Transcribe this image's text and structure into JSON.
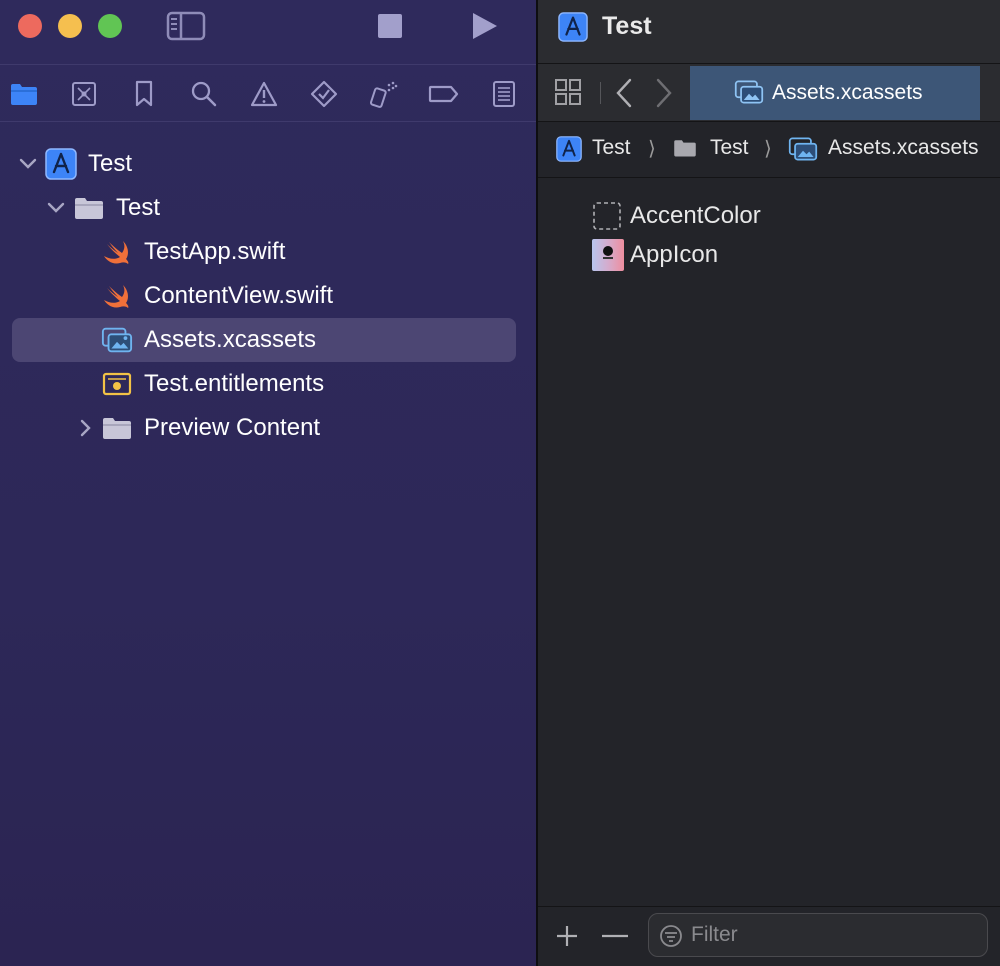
{
  "window": {
    "title": "Test"
  },
  "toolbar": {
    "run_icon": "play-icon",
    "stop_icon": "stop-icon",
    "sidebar_icon": "sidebar-toggle-icon"
  },
  "navigator_tabs": [
    {
      "name": "project-navigator",
      "icon": "folder-icon"
    },
    {
      "name": "source-control",
      "icon": "source-control-icon"
    },
    {
      "name": "bookmarks",
      "icon": "bookmark-icon"
    },
    {
      "name": "find",
      "icon": "magnifier-icon"
    },
    {
      "name": "issues",
      "icon": "warning-icon"
    },
    {
      "name": "tests",
      "icon": "test-diamond-icon"
    },
    {
      "name": "debug",
      "icon": "spray-icon"
    },
    {
      "name": "breakpoints",
      "icon": "breakpoint-icon"
    },
    {
      "name": "reports",
      "icon": "report-icon"
    }
  ],
  "tree": [
    {
      "label": "Test",
      "icon": "xcode-project-icon",
      "expanded": true,
      "level": 0
    },
    {
      "label": "Test",
      "icon": "folder-icon",
      "expanded": true,
      "level": 1
    },
    {
      "label": "TestApp.swift",
      "icon": "swift-icon",
      "level": 2
    },
    {
      "label": "ContentView.swift",
      "icon": "swift-icon",
      "level": 2
    },
    {
      "label": "Assets.xcassets",
      "icon": "asset-catalog-icon",
      "level": 2,
      "selected": true
    },
    {
      "label": "Test.entitlements",
      "icon": "entitlements-icon",
      "level": 2
    },
    {
      "label": "Preview Content",
      "icon": "folder-icon",
      "expanded": false,
      "level": 2
    }
  ],
  "editor": {
    "title": "Test",
    "active_tab": "Assets.xcassets",
    "jumpbar": [
      "Test",
      "Test",
      "Assets.xcassets"
    ],
    "assets": [
      {
        "label": "AccentColor",
        "icon": "color-set-icon"
      },
      {
        "label": "AppIcon",
        "icon": "app-icon-set-icon"
      }
    ],
    "filter": {
      "placeholder": "Filter",
      "value": ""
    }
  },
  "colors": {
    "accent": "#3d84f7",
    "selection": "#4c4673",
    "active_tab": "#3d5677",
    "swift": "#f0703a"
  }
}
